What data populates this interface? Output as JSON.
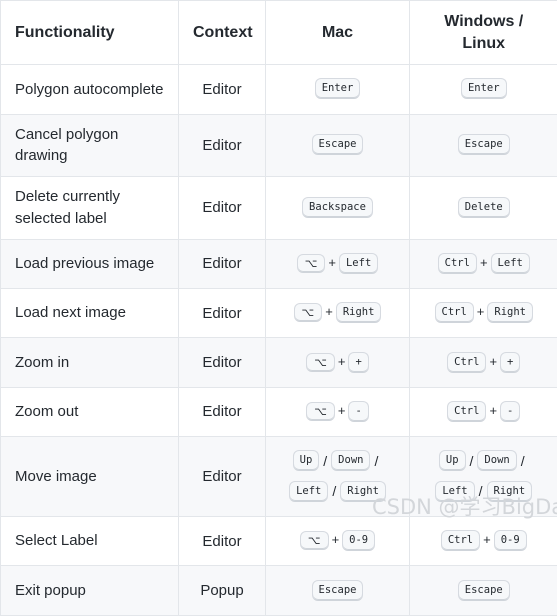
{
  "table": {
    "headers": {
      "functionality": "Functionality",
      "context": "Context",
      "mac": "Mac",
      "windows_linux": "Windows / Linux"
    },
    "rows": [
      {
        "functionality": "Polygon autocomplete",
        "context": "Editor",
        "mac": [
          [
            {
              "type": "key",
              "label": "Enter"
            }
          ]
        ],
        "windows_linux": [
          [
            {
              "type": "key",
              "label": "Enter"
            }
          ]
        ]
      },
      {
        "functionality": "Cancel polygon drawing",
        "context": "Editor",
        "mac": [
          [
            {
              "type": "key",
              "label": "Escape"
            }
          ]
        ],
        "windows_linux": [
          [
            {
              "type": "key",
              "label": "Escape"
            }
          ]
        ]
      },
      {
        "functionality": "Delete currently selected label",
        "context": "Editor",
        "mac": [
          [
            {
              "type": "key",
              "label": "Backspace"
            }
          ]
        ],
        "windows_linux": [
          [
            {
              "type": "key",
              "label": "Delete"
            }
          ]
        ]
      },
      {
        "functionality": "Load previous image",
        "context": "Editor",
        "mac": [
          [
            {
              "type": "modkey",
              "label": "⌥"
            },
            {
              "type": "plus",
              "label": "+"
            },
            {
              "type": "key",
              "label": "Left"
            }
          ]
        ],
        "windows_linux": [
          [
            {
              "type": "key",
              "label": "Ctrl"
            },
            {
              "type": "plus",
              "label": "+"
            },
            {
              "type": "key",
              "label": "Left"
            }
          ]
        ]
      },
      {
        "functionality": "Load next image",
        "context": "Editor",
        "mac": [
          [
            {
              "type": "modkey",
              "label": "⌥"
            },
            {
              "type": "plus",
              "label": "+"
            },
            {
              "type": "key",
              "label": "Right"
            }
          ]
        ],
        "windows_linux": [
          [
            {
              "type": "key",
              "label": "Ctrl"
            },
            {
              "type": "plus",
              "label": "+"
            },
            {
              "type": "key",
              "label": "Right"
            }
          ]
        ]
      },
      {
        "functionality": "Zoom in",
        "context": "Editor",
        "mac": [
          [
            {
              "type": "modkey",
              "label": "⌥"
            },
            {
              "type": "plus",
              "label": "+"
            },
            {
              "type": "key",
              "label": "+"
            }
          ]
        ],
        "windows_linux": [
          [
            {
              "type": "key",
              "label": "Ctrl"
            },
            {
              "type": "plus",
              "label": "+"
            },
            {
              "type": "key",
              "label": "+"
            }
          ]
        ]
      },
      {
        "functionality": "Zoom out",
        "context": "Editor",
        "mac": [
          [
            {
              "type": "modkey",
              "label": "⌥"
            },
            {
              "type": "plus",
              "label": "+"
            },
            {
              "type": "key",
              "label": "-"
            }
          ]
        ],
        "windows_linux": [
          [
            {
              "type": "key",
              "label": "Ctrl"
            },
            {
              "type": "plus",
              "label": "+"
            },
            {
              "type": "key",
              "label": "-"
            }
          ]
        ]
      },
      {
        "functionality": "Move image",
        "context": "Editor",
        "mac": [
          [
            {
              "type": "key",
              "label": "Up"
            },
            {
              "type": "slash",
              "label": "/"
            },
            {
              "type": "key",
              "label": "Down"
            },
            {
              "type": "slash",
              "label": "/"
            }
          ],
          [
            {
              "type": "key",
              "label": "Left"
            },
            {
              "type": "slash",
              "label": "/"
            },
            {
              "type": "key",
              "label": "Right"
            }
          ]
        ],
        "windows_linux": [
          [
            {
              "type": "key",
              "label": "Up"
            },
            {
              "type": "slash",
              "label": "/"
            },
            {
              "type": "key",
              "label": "Down"
            },
            {
              "type": "slash",
              "label": "/"
            }
          ],
          [
            {
              "type": "key",
              "label": "Left"
            },
            {
              "type": "slash",
              "label": "/"
            },
            {
              "type": "key",
              "label": "Right"
            }
          ]
        ]
      },
      {
        "functionality": "Select Label",
        "context": "Editor",
        "mac": [
          [
            {
              "type": "modkey",
              "label": "⌥"
            },
            {
              "type": "plus",
              "label": "+"
            },
            {
              "type": "key",
              "label": "0-9"
            }
          ]
        ],
        "windows_linux": [
          [
            {
              "type": "key",
              "label": "Ctrl"
            },
            {
              "type": "plus",
              "label": "+"
            },
            {
              "type": "key",
              "label": "0-9"
            }
          ]
        ]
      },
      {
        "functionality": "Exit popup",
        "context": "Popup",
        "mac": [
          [
            {
              "type": "key",
              "label": "Escape"
            }
          ]
        ],
        "windows_linux": [
          [
            {
              "type": "key",
              "label": "Escape"
            }
          ]
        ]
      }
    ]
  },
  "watermark": {
    "text": "CSDN @学习BigData"
  },
  "colors": {
    "border": "#e3e6ea",
    "row_stripe": "#f7f8fa",
    "text": "#24292f",
    "kbd_bg": "#f6f8fa",
    "watermark": "#d3d6da"
  }
}
